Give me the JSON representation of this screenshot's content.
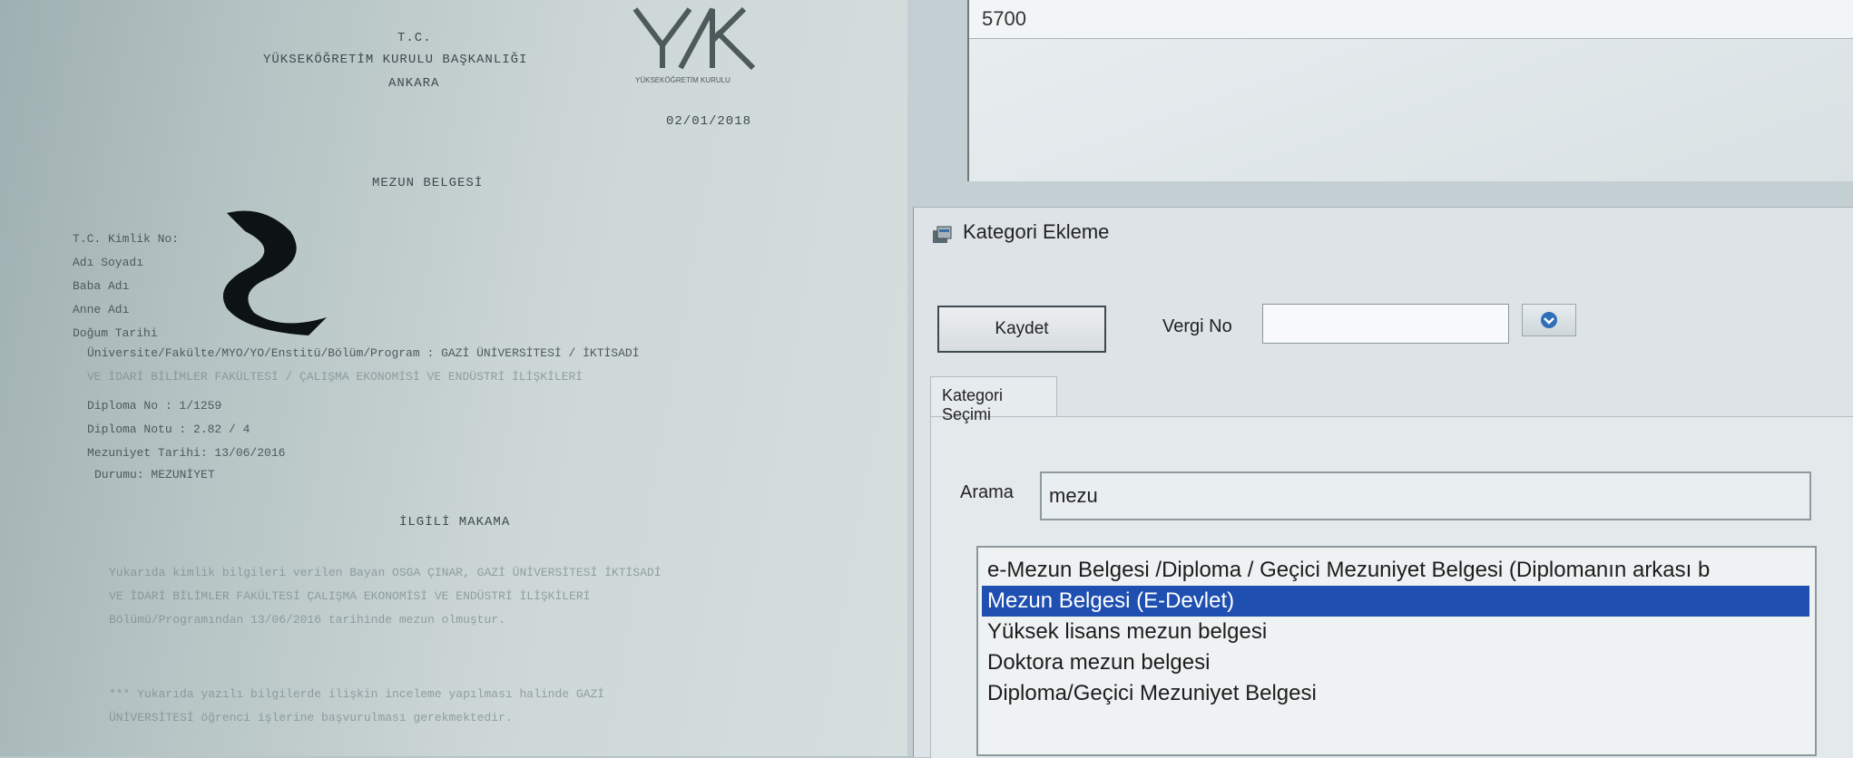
{
  "document": {
    "header_line1": "T.C.",
    "header_line2": "YÜKSEKÖĞRETİM KURULU BAŞKANLIĞI",
    "header_line3": "ANKARA",
    "logo_caption": "YÜKSEKÖĞRETİM KURULU",
    "date": "02/01/2018",
    "title": "MEZUN BELGESİ",
    "fields": [
      "T.C. Kimlik No:",
      "Adı Soyadı",
      "Baba Adı",
      "Anne Adı",
      "Doğum Tarihi"
    ],
    "program_line1": "Üniversite/Fakülte/MYO/YO/Enstitü/Bölüm/Program : GAZİ ÜNİVERSİTESİ / İKTİSADİ",
    "program_line2": "VE İDARİ BİLİMLER FAKÜLTESİ / ÇALIŞMA EKONOMİSİ VE ENDÜSTRİ İLİŞKİLERİ",
    "diploma_no": "Diploma No    : 1/1259",
    "diploma_notu": "Diploma Notu  : 2.82 / 4",
    "mezuniyet_tarihi": "Mezuniyet Tarihi: 13/06/2016",
    "durum": "Durumu: MEZUNİYET",
    "ilgili": "İLGİLİ MAKAMA",
    "body_line1": "Yukarıda kimlik bilgileri verilen Bayan OSGA ÇINAR, GAZİ ÜNİVERSİTESİ İKTİSADİ",
    "body_line2": "VE İDARİ BİLİMLER FAKÜLTESİ ÇALIŞMA EKONOMİSİ VE ENDÜSTRİ İLİŞKİLERİ",
    "body_line3": "Bölümü/Programından 13/06/2016 tarihinde mezun olmuştur.",
    "note_line1": "*** Yukarıda yazılı bilgilerde ilişkin inceleme yapılması halinde GAZİ",
    "note_line2": "ÜNİVERSİTESİ öğrenci işlerine başvurulması gerekmektedir."
  },
  "top_panel": {
    "value": "5700"
  },
  "window": {
    "title": "Kategori Ekleme",
    "save_label": "Kaydet",
    "vergi_label": "Vergi No",
    "vergi_value": "",
    "tab_label": "Kategori Seçimi",
    "arama_label": "Arama",
    "arama_value": "mezu",
    "list": [
      "e-Mezun Belgesi /Diploma / Geçici Mezuniyet Belgesi (Diplomanın arkası b",
      "Mezun Belgesi (E-Devlet)",
      "Yüksek lisans mezun belgesi",
      "Doktora mezun belgesi",
      "Diploma/Geçici Mezuniyet Belgesi"
    ],
    "selected_index": 1
  },
  "colors": {
    "selection": "#1f4fb0",
    "window_bg": "#dde3e6"
  }
}
